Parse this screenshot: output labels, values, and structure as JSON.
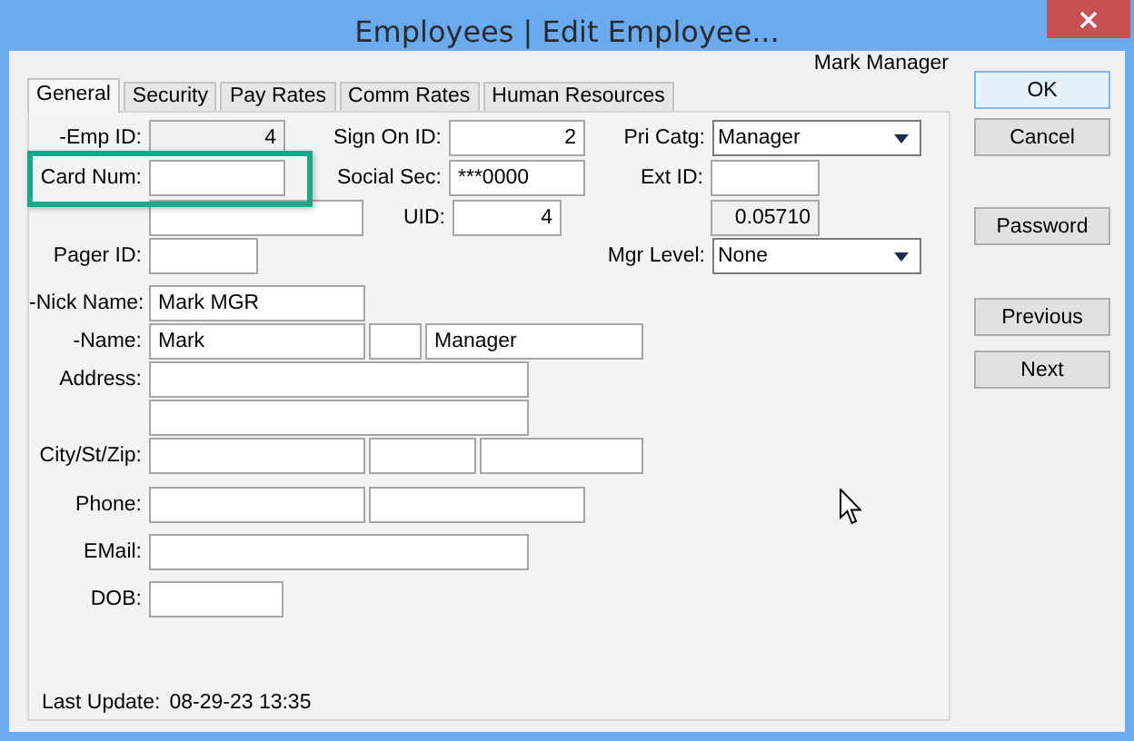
{
  "window": {
    "title": "Employees | Edit Employee..."
  },
  "user": "Mark Manager",
  "tabs": [
    {
      "label": "General",
      "selected": true
    },
    {
      "label": "Security",
      "selected": false
    },
    {
      "label": "Pay Rates",
      "selected": false
    },
    {
      "label": "Comm Rates",
      "selected": false
    },
    {
      "label": "Human Resources",
      "selected": false
    }
  ],
  "form_rows": [
    {
      "groups": [
        {
          "label": "-Emp ID:",
          "fields": [
            {
              "kind": "number",
              "value": "4",
              "readonly": true
            }
          ]
        },
        {
          "label": "Sign On ID:",
          "fields": [
            {
              "kind": "number",
              "value": "2",
              "readonly": false
            }
          ]
        },
        {
          "label": "Pri Catg:",
          "fields": [
            {
              "kind": "select",
              "value": "Manager",
              "readonly": false
            }
          ]
        }
      ]
    },
    {
      "groups": [
        {
          "label": "Card Num:",
          "fields": [
            {
              "kind": "text",
              "readonly": false
            }
          ]
        },
        {
          "label": "Social Sec:",
          "fields": [
            {
              "kind": "text",
              "value": "***0000",
              "readonly": false
            }
          ]
        },
        {
          "label": "Ext ID:",
          "fields": [
            {
              "kind": "text",
              "readonly": false
            }
          ]
        }
      ]
    },
    {
      "groups": [
        {
          "fields": [
            {
              "kind": "text",
              "readonly": false
            }
          ]
        },
        {
          "label": "UID:",
          "fields": [
            {
              "kind": "number",
              "value": "4",
              "readonly": false
            }
          ]
        },
        {
          "fields": [
            {
              "kind": "number",
              "value": "0.05710",
              "readonly": true
            }
          ]
        }
      ]
    },
    {
      "groups": [
        {
          "label": "Pager ID:",
          "fields": [
            {
              "kind": "text",
              "readonly": false
            }
          ]
        },
        {
          "label": "Mgr Level:",
          "fields": [
            {
              "kind": "select",
              "value": "None",
              "readonly": false
            }
          ]
        }
      ]
    },
    {
      "groups": [
        {
          "label": "-Nick Name:",
          "fields": [
            {
              "kind": "text",
              "value": "Mark MGR",
              "readonly": false
            }
          ]
        }
      ]
    },
    {
      "groups": [
        {
          "label": "-Name:",
          "fields": [
            {
              "kind": "text",
              "value": "Mark",
              "readonly": false
            },
            {
              "kind": "text",
              "readonly": false
            },
            {
              "kind": "text",
              "value": "Manager",
              "readonly": false
            }
          ]
        }
      ]
    },
    {
      "groups": [
        {
          "label": "Address:",
          "fields": [
            {
              "kind": "text",
              "readonly": false
            }
          ]
        }
      ]
    },
    {
      "groups": [
        {
          "fields": [
            {
              "kind": "text",
              "readonly": false
            }
          ]
        }
      ]
    },
    {
      "groups": [
        {
          "label": "City/St/Zip:",
          "fields": [
            {
              "kind": "text",
              "readonly": false
            },
            {
              "kind": "text",
              "readonly": false
            },
            {
              "kind": "text",
              "readonly": false
            }
          ]
        }
      ]
    },
    {
      "groups": [
        {
          "label": "Phone:",
          "fields": [
            {
              "kind": "text",
              "readonly": false
            },
            {
              "kind": "text",
              "readonly": false
            }
          ]
        }
      ]
    },
    {
      "groups": [
        {
          "label": "EMail:",
          "fields": [
            {
              "kind": "text",
              "readonly": false
            }
          ]
        }
      ]
    },
    {
      "groups": [
        {
          "label": "DOB:",
          "fields": [
            {
              "kind": "text",
              "readonly": false
            }
          ]
        }
      ]
    }
  ],
  "last_update": {
    "label": "Last Update:",
    "value": "08-29-23 13:35"
  },
  "buttons": [
    {
      "label": "OK",
      "default": true
    },
    {
      "label": "Cancel",
      "default": false
    },
    {
      "label": "Password",
      "default": false
    },
    {
      "label": "Previous",
      "default": false
    },
    {
      "label": "Next",
      "default": false
    }
  ]
}
